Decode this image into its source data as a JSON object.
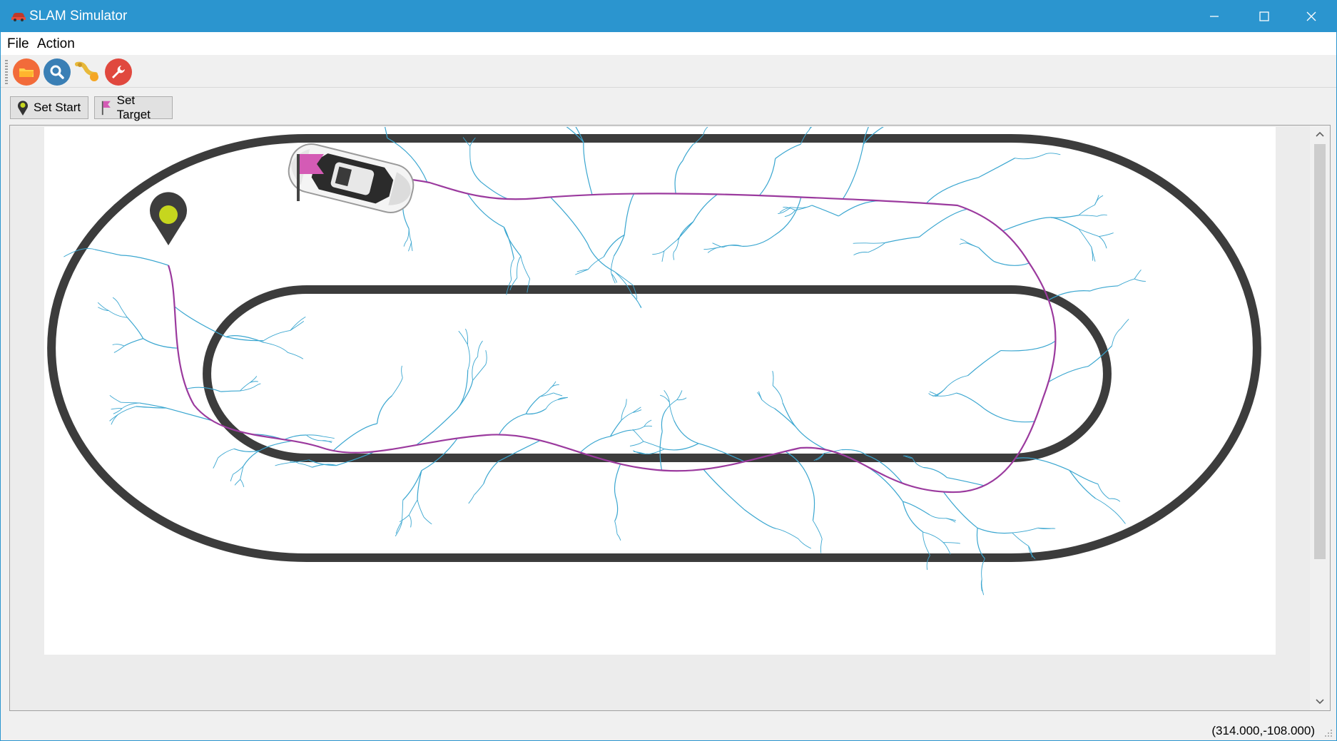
{
  "window": {
    "title": "SLAM Simulator",
    "controls": {
      "minimize": "minimize-icon",
      "maximize": "maximize-icon",
      "close": "close-icon"
    }
  },
  "menu": {
    "items": [
      "File",
      "Action"
    ]
  },
  "toolbar": {
    "tools": [
      {
        "name": "open-folder-icon",
        "color": "#f26b3a"
      },
      {
        "name": "search-icon",
        "color": "#3a7fb5"
      },
      {
        "name": "path-icon",
        "color": "#e8b93a"
      },
      {
        "name": "settings-icon",
        "color": "#e0483e"
      }
    ]
  },
  "buttons": {
    "set_start": "Set Start",
    "set_target": "Set Target"
  },
  "scene": {
    "track_color": "#3c3c3c",
    "tree_color": "#3aa6d0",
    "path_color": "#9b3a9e",
    "start_marker_color": "#c6d61e",
    "target_flag_color": "#d45bb5"
  },
  "status": {
    "coordinates": "(314.000,-108.000)"
  }
}
